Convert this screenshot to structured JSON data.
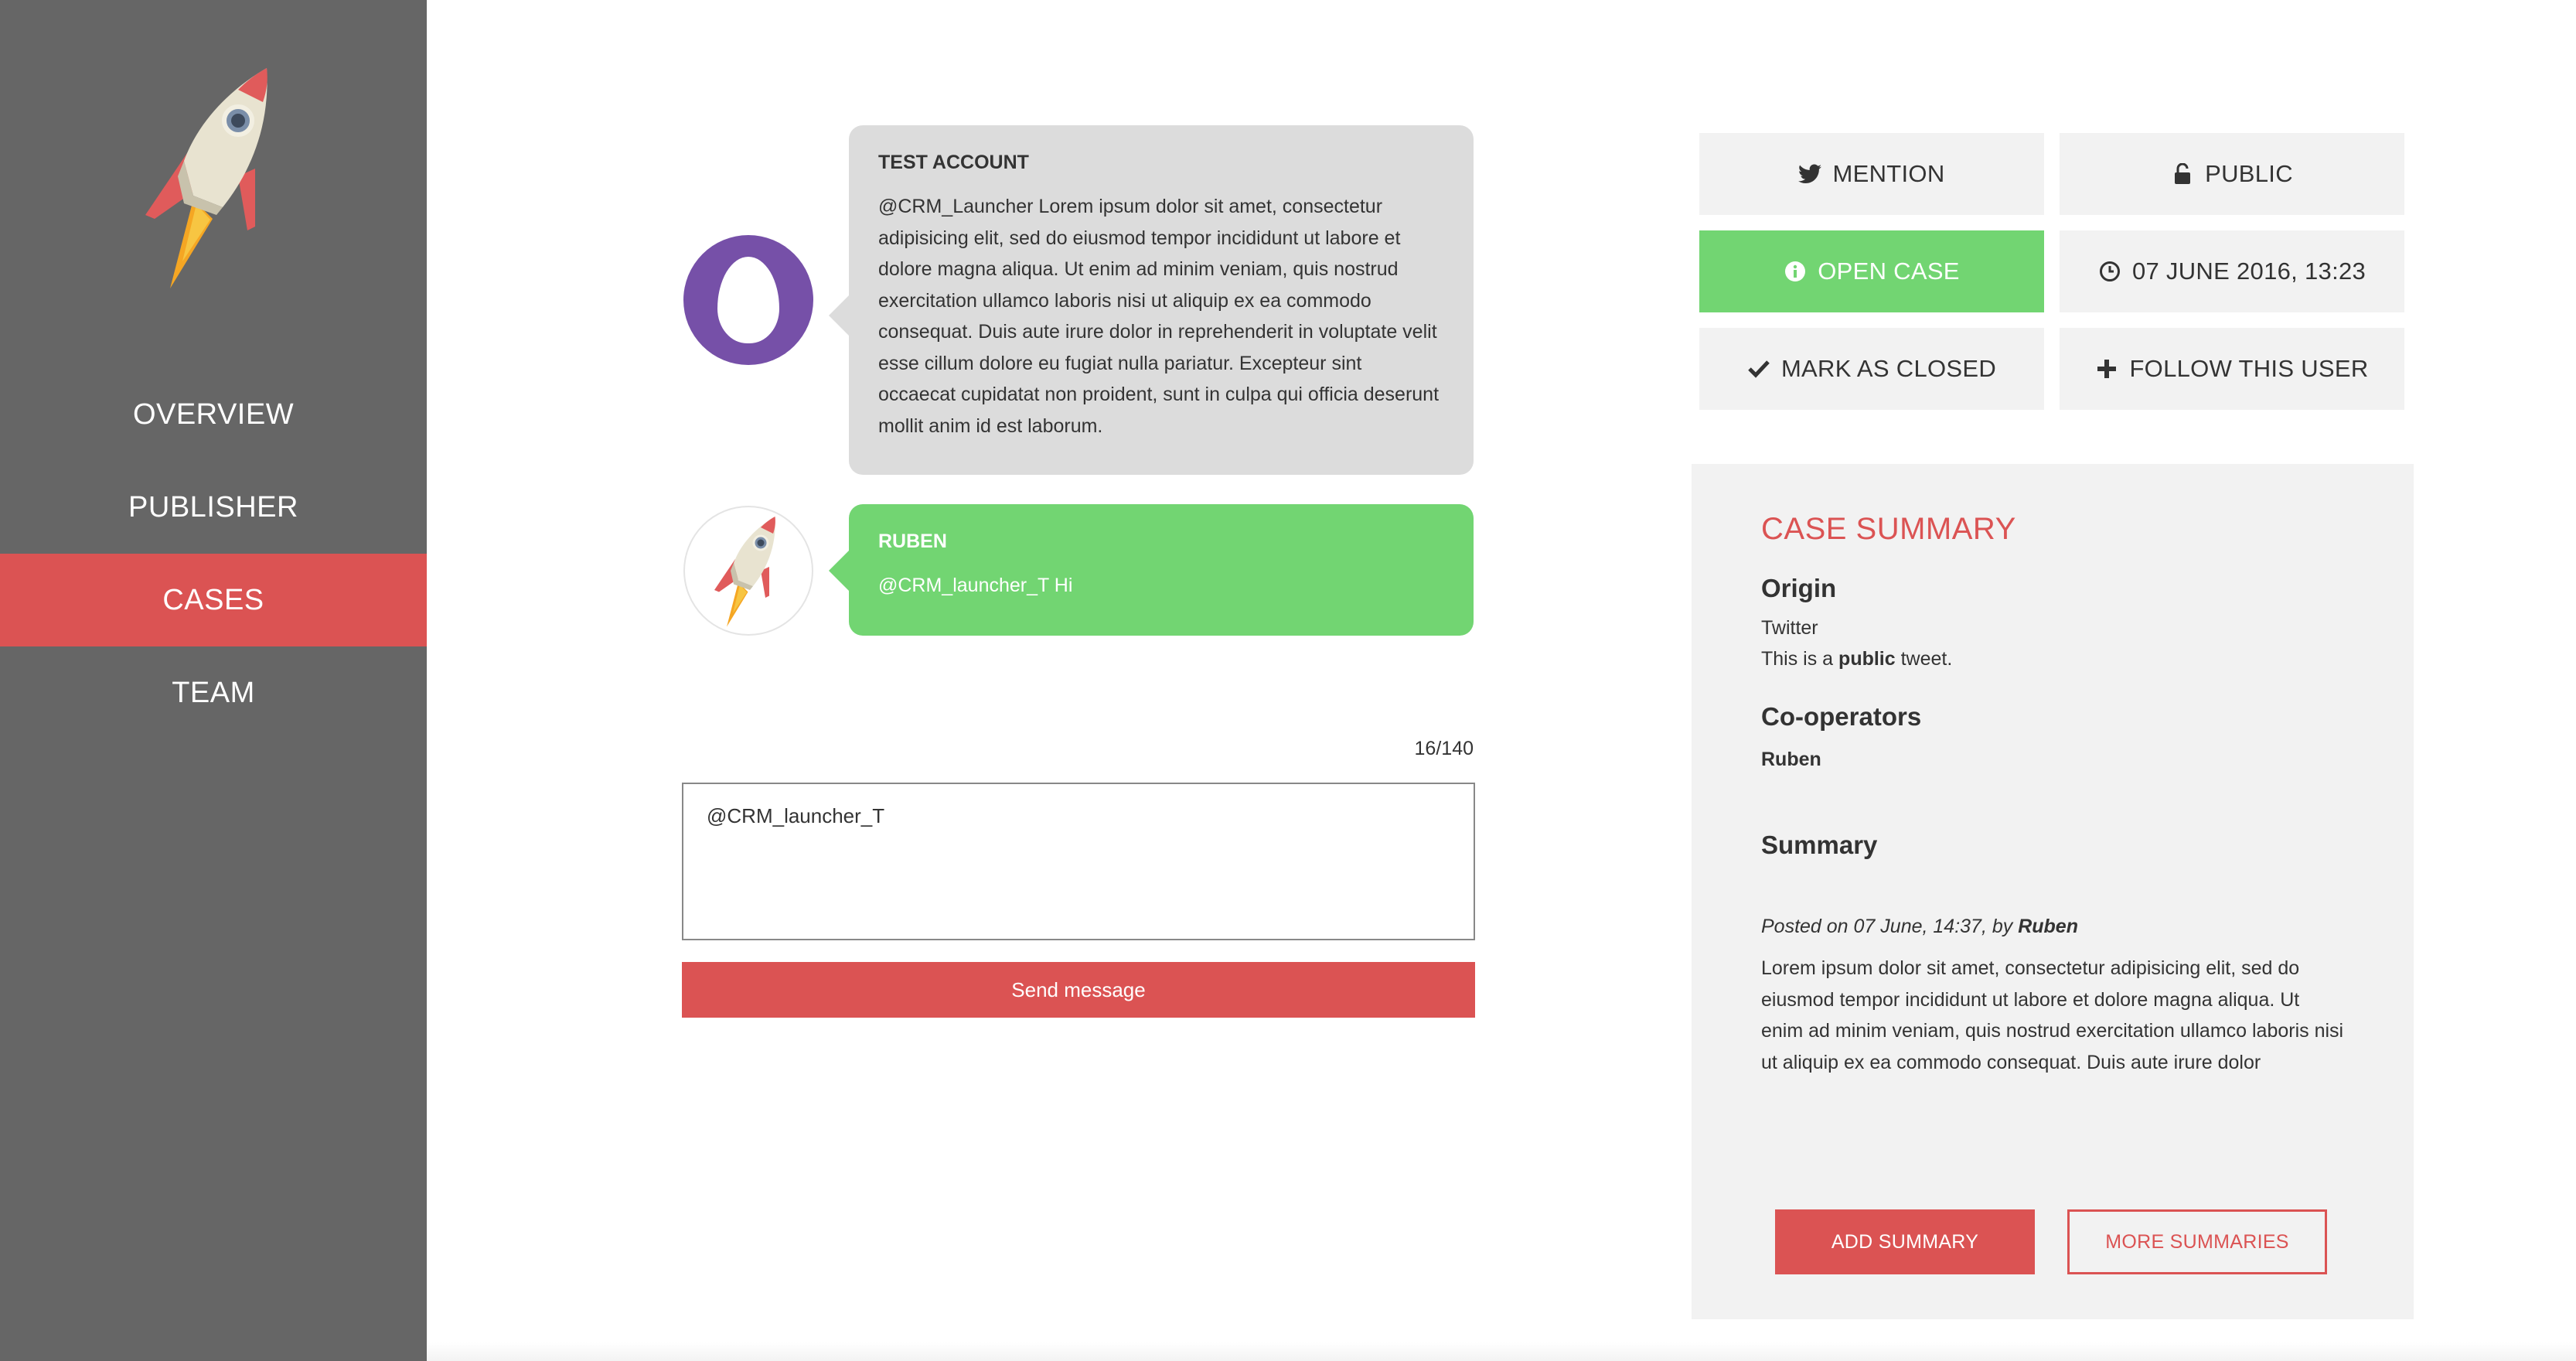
{
  "sidebar": {
    "logo_icon": "rocket-icon",
    "items": [
      {
        "label": "OVERVIEW",
        "active": false
      },
      {
        "label": "PUBLISHER",
        "active": false
      },
      {
        "label": "CASES",
        "active": true
      },
      {
        "label": "TEAM",
        "active": false
      }
    ]
  },
  "conversation": {
    "messages": [
      {
        "sender": "TEST ACCOUNT",
        "text": "@CRM_Launcher Lorem ipsum dolor sit amet, consectetur adipisicing elit, sed do eiusmod tempor incididunt ut labore et dolore magna aliqua. Ut enim ad minim veniam, quis nostrud exercitation ullamco laboris nisi ut aliquip ex ea commodo consequat. Duis aute irure dolor in reprehenderit in voluptate velit esse cillum dolore eu fugiat nulla pariatur. Excepteur sint occaecat cupidatat non proident, sunt in culpa qui officia deserunt mollit anim id est laborum.",
        "avatar_icon": "egg-avatar-icon"
      },
      {
        "sender": "RUBEN",
        "text": "@CRM_launcher_T Hi",
        "avatar_icon": "rocket-avatar-icon"
      }
    ]
  },
  "compose": {
    "counter": "16/140",
    "value": "@CRM_launcher_T",
    "send_label": "Send message"
  },
  "actions": {
    "mention": {
      "label": "MENTION",
      "icon": "twitter-icon"
    },
    "public": {
      "label": "PUBLIC",
      "icon": "unlock-icon"
    },
    "open_case": {
      "label": "OPEN CASE",
      "icon": "info-icon"
    },
    "date": {
      "label": "07 JUNE 2016, 13:23",
      "icon": "clock-icon"
    },
    "mark_closed": {
      "label": "MARK AS CLOSED",
      "icon": "check-icon"
    },
    "follow": {
      "label": "FOLLOW THIS USER",
      "icon": "plus-icon"
    }
  },
  "case_summary": {
    "title": "CASE SUMMARY",
    "origin_title": "Origin",
    "origin_value": "Twitter",
    "origin_desc_prefix": "This is a",
    "origin_desc_bold": "public",
    "origin_desc_suffix": "tweet.",
    "cooperators_title": "Co-operators",
    "cooperators": [
      "Ruben"
    ],
    "summary_title": "Summary",
    "posted_prefix": "Posted on 07 June, 14:37, by",
    "posted_by": "Ruben",
    "summary_text": "Lorem ipsum dolor sit amet, consectetur adipisicing elit, sed do eiusmod tempor incididunt ut labore et dolore magna aliqua. Ut enim ad minim veniam, quis nostrud exercitation ullamco laboris nisi ut aliquip ex ea commodo consequat. Duis aute irure dolor",
    "add_label": "ADD SUMMARY",
    "more_label": "MORE SUMMARIES"
  },
  "colors": {
    "sidebar": "#666666",
    "accent_red": "#db5353",
    "accent_green": "#72d572",
    "bubble_grey": "#dcdcdc",
    "panel_grey": "#f2f2f2",
    "avatar_purple": "#7650a8"
  }
}
